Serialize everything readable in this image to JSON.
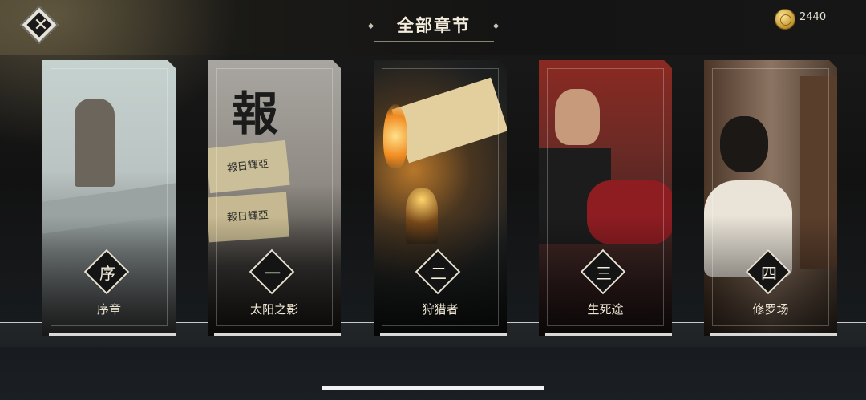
{
  "header": {
    "title": "全部章节",
    "coins": "2440"
  },
  "chapters": [
    {
      "badge": "序",
      "name": "序章"
    },
    {
      "badge": "一",
      "name": "太阳之影"
    },
    {
      "badge": "二",
      "name": "狩猎者"
    },
    {
      "badge": "三",
      "name": "生死途"
    },
    {
      "badge": "四",
      "name": "修罗场"
    }
  ],
  "art_text": {
    "card1_big_char": "報",
    "card1_sign_a": "報日輝亞",
    "card1_sign_b": "報日輝亞"
  },
  "icons": {
    "close": "close-icon",
    "coin": "coin-icon"
  },
  "colors": {
    "accent": "#e8e2d2",
    "background": "#141414"
  }
}
